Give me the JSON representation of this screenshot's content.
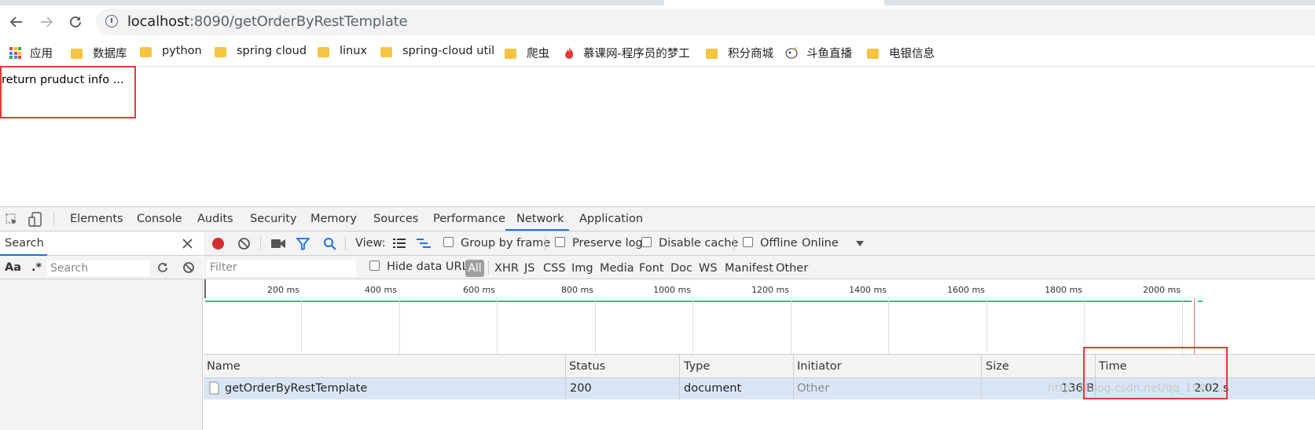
{
  "browser": {
    "url_host": "localhost",
    "url_rest": ":8090/getOrderByRestTemplate",
    "bookmarks": [
      {
        "label": "应用",
        "icon": "apps-grid-icon"
      },
      {
        "label": "数据库",
        "icon": "folder-icon"
      },
      {
        "label": "python",
        "icon": "folder-icon"
      },
      {
        "label": "spring cloud",
        "icon": "folder-icon"
      },
      {
        "label": "linux",
        "icon": "folder-icon"
      },
      {
        "label": "spring-cloud util",
        "icon": "folder-icon"
      },
      {
        "label": "爬虫",
        "icon": "folder-icon"
      },
      {
        "label": "慕课网-程序员的梦工",
        "icon": "flame-icon"
      },
      {
        "label": "积分商城",
        "icon": "folder-icon"
      },
      {
        "label": "斗鱼直播",
        "icon": "douyu-icon"
      },
      {
        "label": "电银信息",
        "icon": "folder-icon"
      }
    ]
  },
  "page": {
    "body_text": "return pruduct info ..."
  },
  "devtools": {
    "tabs": [
      "Elements",
      "Console",
      "Audits",
      "Security",
      "Memory",
      "Sources",
      "Performance",
      "Network",
      "Application"
    ],
    "active_tab": "Network",
    "search_panel": {
      "title": "Search",
      "aa_label": "Aa",
      "regex_label": ".*",
      "input_placeholder": "Search"
    },
    "network_toolbar": {
      "view_label": "View:",
      "group_by_frame": "Group by frame",
      "preserve_log": "Preserve log",
      "disable_cache": "Disable cache",
      "offline": "Offline",
      "throttling": "Online"
    },
    "filter_bar": {
      "filter_placeholder": "Filter",
      "hide_data_urls": "Hide data URLs",
      "types": [
        "All",
        "XHR",
        "JS",
        "CSS",
        "Img",
        "Media",
        "Font",
        "Doc",
        "WS",
        "Manifest",
        "Other"
      ]
    },
    "timeline_ticks": [
      "200 ms",
      "400 ms",
      "600 ms",
      "800 ms",
      "1000 ms",
      "1200 ms",
      "1400 ms",
      "1600 ms",
      "1800 ms",
      "2000 ms"
    ],
    "table": {
      "columns": [
        "Name",
        "Status",
        "Type",
        "Initiator",
        "Size",
        "Time"
      ],
      "rows": [
        {
          "name": "getOrderByRestTemplate",
          "status": "200",
          "type": "document",
          "initiator": "Other",
          "size": "136 B",
          "time": "2.02 s"
        }
      ]
    },
    "watermark": "https://blog.csdn.net/qq_1940..."
  },
  "colors": {
    "accent": "#1a73e8",
    "highlight_border": "#e53935",
    "timeline_bar": "#2ec47a",
    "record_dot": "#d32f2f",
    "selected_row": "#dae6f5"
  }
}
